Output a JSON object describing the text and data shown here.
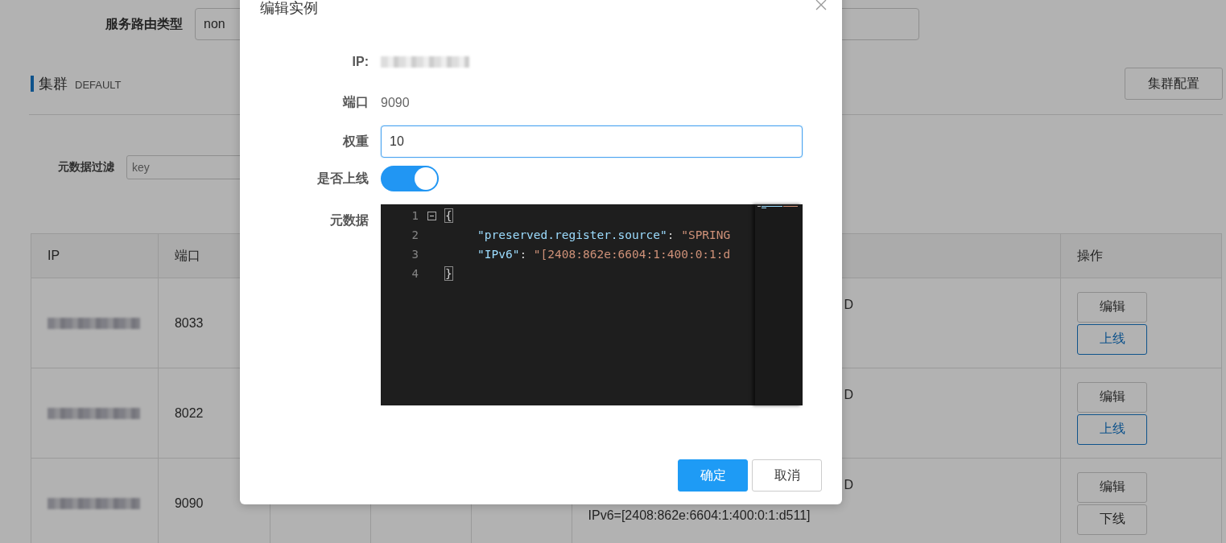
{
  "filter_bar": {
    "route_type_label": "服务路由类型",
    "route_type_value": "non"
  },
  "cluster": {
    "title": "集群",
    "name": "DEFAULT",
    "config_button": "集群配置"
  },
  "metadata_filter": {
    "label": "元数据过滤",
    "placeholder": "key"
  },
  "table": {
    "columns": [
      "IP",
      "端口",
      "操作"
    ],
    "rows": [
      {
        "port": "8033",
        "metadata": [
          "D"
        ],
        "edit": "编辑",
        "toggle": {
          "label": "上线",
          "kind": "online"
        }
      },
      {
        "port": "8022",
        "metadata": [
          "D"
        ],
        "edit": "编辑",
        "toggle": {
          "label": "上线",
          "kind": "online"
        }
      },
      {
        "port": "9090",
        "metadata": [
          "D",
          "IPv6=[2408:862e:6604:1:400:0:1:d511]"
        ],
        "edit": "编辑",
        "toggle": {
          "label": "下线",
          "kind": "offline"
        }
      }
    ]
  },
  "dialog": {
    "title": "编辑实例",
    "ip_label": "IP:",
    "port_label": "端口",
    "port_value": "9090",
    "weight_label": "权重",
    "weight_value": "10",
    "online_label": "是否上线",
    "online": true,
    "metadata_label": "元数据",
    "code_lines": [
      {
        "number": "1",
        "foldable": true,
        "tokens": [
          {
            "kind": "bracket",
            "text": "{"
          }
        ]
      },
      {
        "number": "2",
        "foldable": false,
        "tokens": [
          {
            "kind": "key",
            "text": "\"preserved.register.source\""
          },
          {
            "kind": "punct",
            "text": ": "
          },
          {
            "kind": "string",
            "text": "\"SPRING"
          }
        ]
      },
      {
        "number": "3",
        "foldable": false,
        "tokens": [
          {
            "kind": "key",
            "text": "\"IPv6\""
          },
          {
            "kind": "punct",
            "text": ": "
          },
          {
            "kind": "string",
            "text": "\"[2408:862e:6604:1:400:0:1:d"
          }
        ]
      },
      {
        "number": "4",
        "foldable": false,
        "tokens": [
          {
            "kind": "bracket",
            "text": "}"
          }
        ]
      }
    ],
    "ok_button": "确定",
    "cancel_button": "取消"
  }
}
